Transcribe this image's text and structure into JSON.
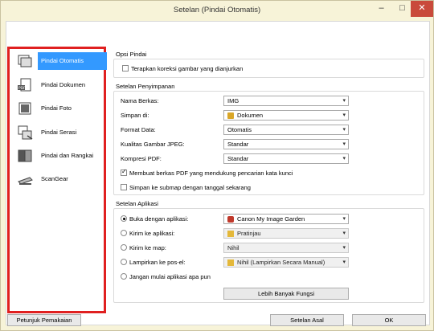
{
  "window": {
    "title": "Setelan (Pindai Otomatis)",
    "minimize": "–",
    "maximize": "□",
    "close": "✕"
  },
  "tabs": [
    {
      "icon": "scan-settings-icon"
    },
    {
      "icon": "tools-icon"
    }
  ],
  "sidebar": {
    "items": [
      {
        "label": "Pindai Otomatis",
        "icon": "auto-scan-icon",
        "selected": true
      },
      {
        "label": "Pindai Dokumen",
        "icon": "document-scan-icon"
      },
      {
        "label": "Pindai Foto",
        "icon": "photo-scan-icon"
      },
      {
        "label": "Pindai Serasi",
        "icon": "custom-scan-icon"
      },
      {
        "label": "Pindai dan Rangkai",
        "icon": "scan-and-stitch-icon"
      },
      {
        "label": "ScanGear",
        "icon": "scangear-icon"
      }
    ]
  },
  "opsi": {
    "title": "Opsi Pindai",
    "apply_correction": "Terapkan koreksi gambar yang dianjurkan"
  },
  "penyimpanan": {
    "title": "Setelan Penyimpanan",
    "nama_label": "Nama Berkas:",
    "nama_value": "IMG",
    "simpan_label": "Simpan di:",
    "simpan_value": "Dokumen",
    "format_label": "Format Data:",
    "format_value": "Otomatis",
    "jpeg_label": "Kualitas Gambar JPEG:",
    "jpeg_value": "Standar",
    "pdf_label": "Kompresi PDF:",
    "pdf_value": "Standar",
    "pdf_keyword": "Membuat berkas PDF yang mendukung pencarian kata kunci",
    "subfolder": "Simpan ke submap dengan tanggal sekarang"
  },
  "aplikasi": {
    "title": "Setelan Aplikasi",
    "buka_label": "Buka dengan aplikasi:",
    "buka_value": "Canon My Image Garden",
    "kirim_app_label": "Kirim ke aplikasi:",
    "kirim_app_value": "Pratinjau",
    "kirim_map_label": "Kirim ke map:",
    "kirim_map_value": "Nihil",
    "email_label": "Lampirkan ke pos-el:",
    "email_value": "Nihil (Lampirkan Secara Manual)",
    "jangan_label": "Jangan mulai aplikasi apa pun",
    "more_button": "Lebih Banyak Fungsi"
  },
  "footer": {
    "help": "Petunjuk Pemakaian",
    "defaults": "Setelan Asal",
    "ok": "OK"
  }
}
